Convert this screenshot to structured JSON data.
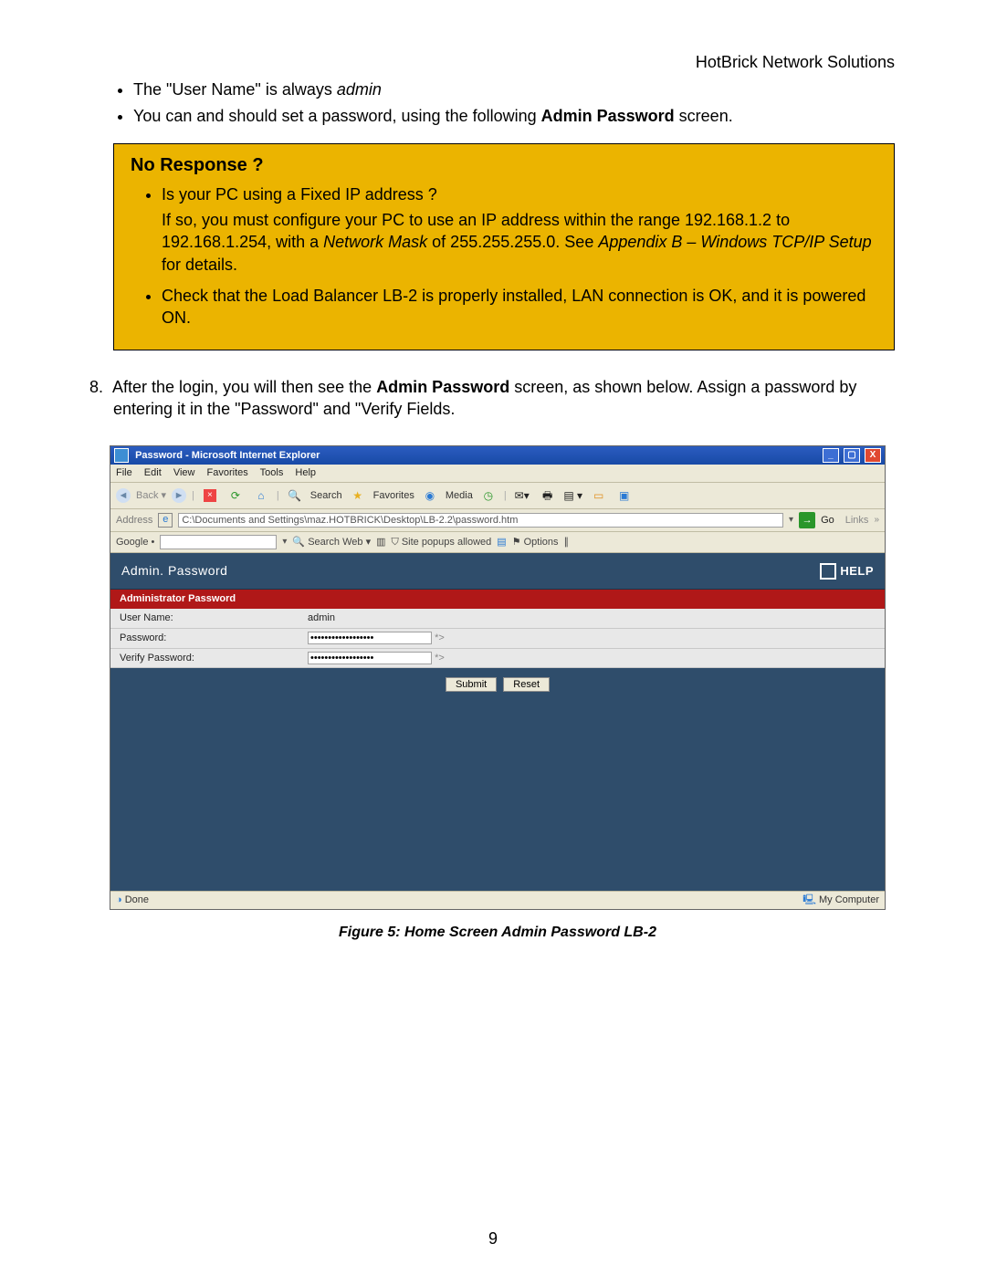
{
  "header_right": "HotBrick Network Solutions",
  "intro_bullets": {
    "a_pre": "The \"User Name\" is always ",
    "a_italic": "admin",
    "b_pre": "You can and should set a password, using the following ",
    "b_bold": "Admin Password",
    "b_post": " screen."
  },
  "callout": {
    "title": "No Response ?",
    "b1": "Is your PC using a Fixed IP address ?",
    "p2_a": "If so, you must configure your PC to use an IP address within the range 192.168.1.2 to 192.168.1.254, with a ",
    "p2_ital1": "Network Mask",
    "p2_b": " of 255.255.255.0. See ",
    "p2_ital2": "Appendix B – Windows TCP/IP Setup",
    "p2_c": " for details.",
    "b3": "Check that the Load Balancer LB-2 is properly installed, LAN connection is OK, and it is powered ON."
  },
  "step8": {
    "num": "8.  ",
    "a": "After the login, you will then see the ",
    "bold": "Admin Password",
    "b": " screen, as shown below. Assign a password by entering it in the \"Password\" and \"Verify Fields."
  },
  "ie": {
    "title": "Password - Microsoft Internet Explorer",
    "menu": [
      "File",
      "Edit",
      "View",
      "Favorites",
      "Tools",
      "Help"
    ],
    "toolbar": {
      "search": "Search",
      "favorites": "Favorites",
      "media": "Media"
    },
    "address_label": "Address",
    "address_value": "C:\\Documents and Settings\\maz.HOTBRICK\\Desktop\\LB-2.2\\password.htm",
    "go": "Go",
    "links": "Links",
    "google": {
      "label": "Google •",
      "searchweb": "Search Web",
      "popups": "Site popups allowed",
      "options": "Options"
    },
    "admin_head": "Admin. Password",
    "help": "HELP",
    "section": "Administrator Password",
    "rows": {
      "user_lbl": "User Name:",
      "user_val": "admin",
      "pw_lbl": "Password:",
      "pw_val": "••••••••••••••••••",
      "vpw_lbl": "Verify Password:",
      "vpw_val": "••••••••••••••••••"
    },
    "buttons": {
      "submit": "Submit",
      "reset": "Reset"
    },
    "status_left": "Done",
    "status_right": "My Computer"
  },
  "caption": "Figure 5: Home Screen Admin Password LB-2",
  "page_number": "9"
}
